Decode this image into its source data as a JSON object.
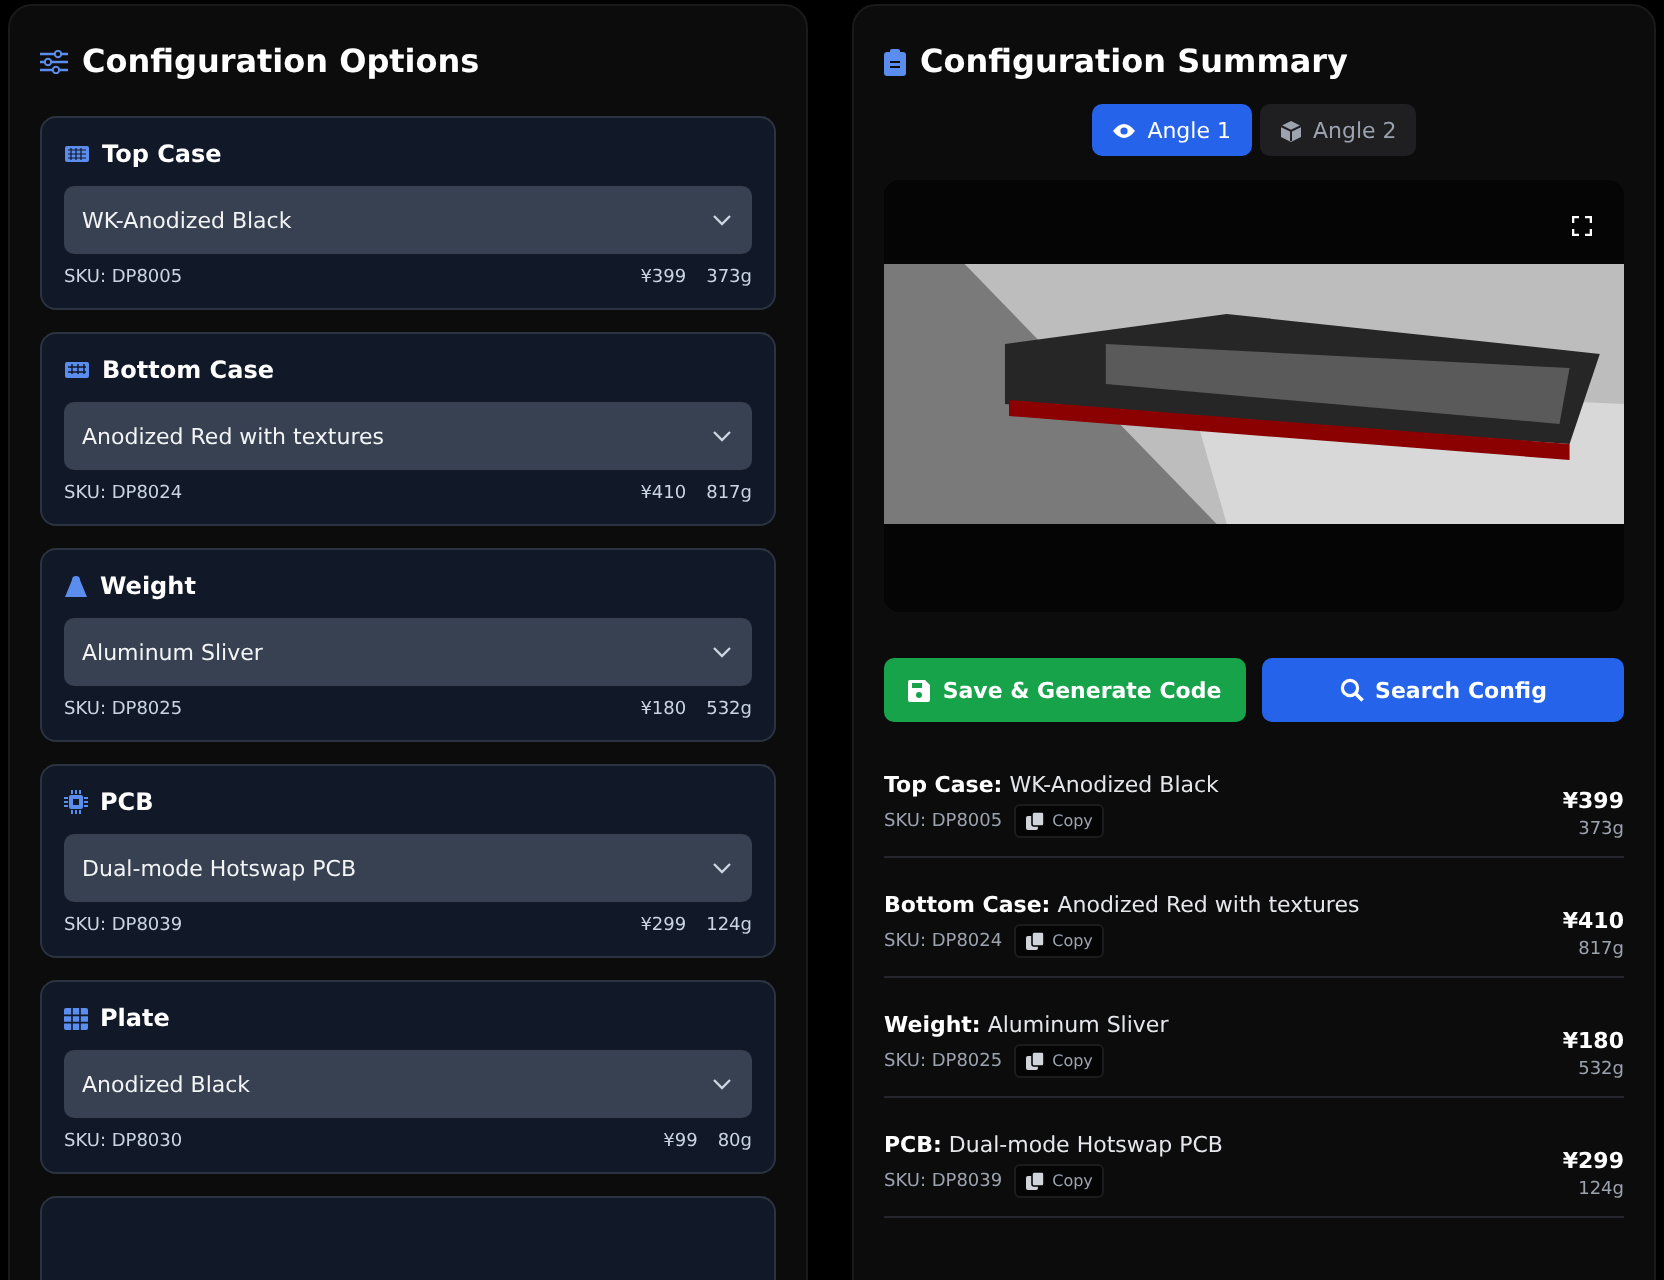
{
  "options_panel": {
    "title": "Configuration Options",
    "options": [
      {
        "label": "Top Case",
        "value": "WK-Anodized Black",
        "sku": "SKU: DP8005",
        "price": "¥399",
        "weight": "373g"
      },
      {
        "label": "Bottom Case",
        "value": "Anodized Red with textures",
        "sku": "SKU: DP8024",
        "price": "¥410",
        "weight": "817g"
      },
      {
        "label": "Weight",
        "value": "Aluminum Sliver",
        "sku": "SKU: DP8025",
        "price": "¥180",
        "weight": "532g"
      },
      {
        "label": "PCB",
        "value": "Dual-mode Hotswap PCB",
        "sku": "SKU: DP8039",
        "price": "¥299",
        "weight": "124g"
      },
      {
        "label": "Plate",
        "value": "Anodized Black",
        "sku": "SKU: DP8030",
        "price": "¥99",
        "weight": "80g"
      }
    ]
  },
  "summary_panel": {
    "title": "Configuration Summary",
    "view_tabs": [
      {
        "label": "Angle 1",
        "selected": true
      },
      {
        "label": "Angle 2",
        "selected": false
      }
    ],
    "buttons": [
      {
        "label": "Save & Generate Code",
        "kind": "save"
      },
      {
        "label": "Search Config",
        "kind": "search"
      }
    ],
    "items": [
      {
        "text": "**Top Case:** WK-Anodized Black",
        "sku": "SKU: DP8005",
        "copy": "Copy",
        "price": "¥399",
        "weight": "373g"
      },
      {
        "text": "**Bottom Case:** Anodized Red with textures",
        "sku": "SKU: DP8024",
        "copy": "Copy",
        "price": "¥410",
        "weight": "817g"
      },
      {
        "text": "**Weight:** Aluminum Sliver",
        "sku": "SKU: DP8025",
        "copy": "Copy",
        "price": "¥180",
        "weight": "532g"
      },
      {
        "text": "**PCB:** Dual-mode Hotswap PCB",
        "sku": "SKU: DP8039",
        "copy": "Copy",
        "price": "¥299",
        "weight": "124g"
      }
    ]
  }
}
